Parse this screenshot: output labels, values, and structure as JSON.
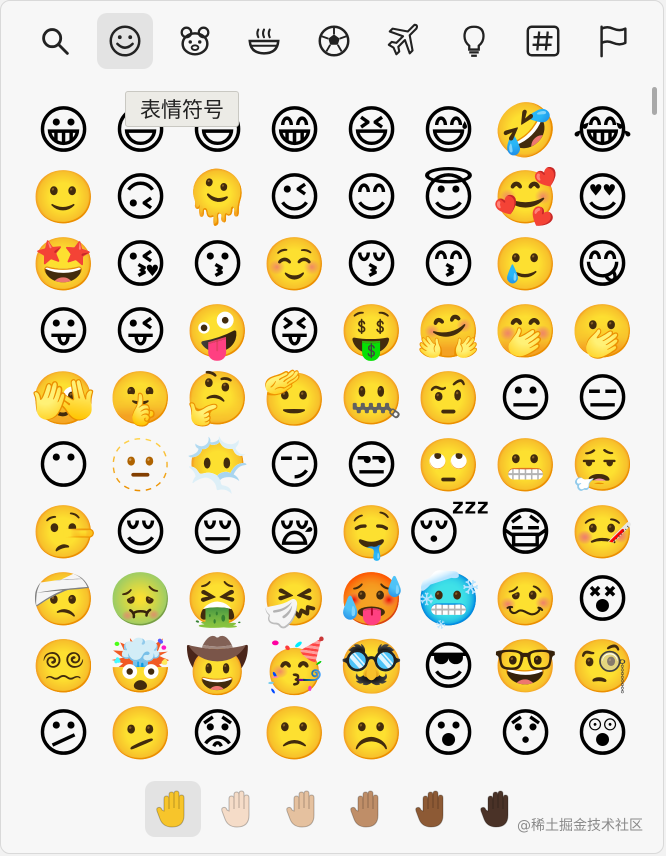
{
  "toolbar": {
    "items": [
      {
        "icon": "search-icon"
      },
      {
        "icon": "smiley-icon",
        "active": true
      },
      {
        "icon": "animal-icon"
      },
      {
        "icon": "food-icon"
      },
      {
        "icon": "soccer-ball-icon"
      },
      {
        "icon": "airplane-icon"
      },
      {
        "icon": "lightbulb-icon"
      },
      {
        "icon": "symbols-hash-icon"
      },
      {
        "icon": "flag-icon"
      }
    ]
  },
  "tooltip": {
    "text": "表情符号"
  },
  "emoji_grid": {
    "rows": [
      [
        "😀",
        "😃",
        "😄",
        "😁",
        "😆",
        "😅",
        "🤣",
        "😂"
      ],
      [
        "🙂",
        "🙃",
        "🫠",
        "😉",
        "😊",
        "😇",
        "🥰",
        "😍"
      ],
      [
        "🤩",
        "😘",
        "😗",
        "☺️",
        "😚",
        "😙",
        "🥲",
        "😋"
      ],
      [
        "😛",
        "😜",
        "🤪",
        "😝",
        "🤑",
        "🤗",
        "🤭",
        "🫢"
      ],
      [
        "🫣",
        "🤫",
        "🤔",
        "🫡",
        "🤐",
        "🤨",
        "😐",
        "😑"
      ],
      [
        "😶",
        "🫥",
        "😶‍🌫️",
        "😏",
        "😒",
        "🙄",
        "😬",
        "😮‍💨"
      ],
      [
        "🤥",
        "😌",
        "😔",
        "😪",
        "🤤",
        "😴",
        "😷",
        "🤒"
      ],
      [
        "🤕",
        "🤢",
        "🤮",
        "🤧",
        "🥵",
        "🥶",
        "🥴",
        "😵"
      ],
      [
        "😵‍💫",
        "🤯",
        "🤠",
        "🥳",
        "🥸",
        "😎",
        "🤓",
        "🧐"
      ],
      [
        "😕",
        "🫤",
        "😟",
        "🙁",
        "☹️",
        "😮",
        "😯",
        "😲"
      ]
    ]
  },
  "skin_tones": {
    "selected": 0,
    "colors": [
      "#f7c52b",
      "#f5dcc8",
      "#e5c19f",
      "#bf8e68",
      "#8d5a35",
      "#4a3227"
    ]
  },
  "watermark": "@稀土掘金技术社区"
}
